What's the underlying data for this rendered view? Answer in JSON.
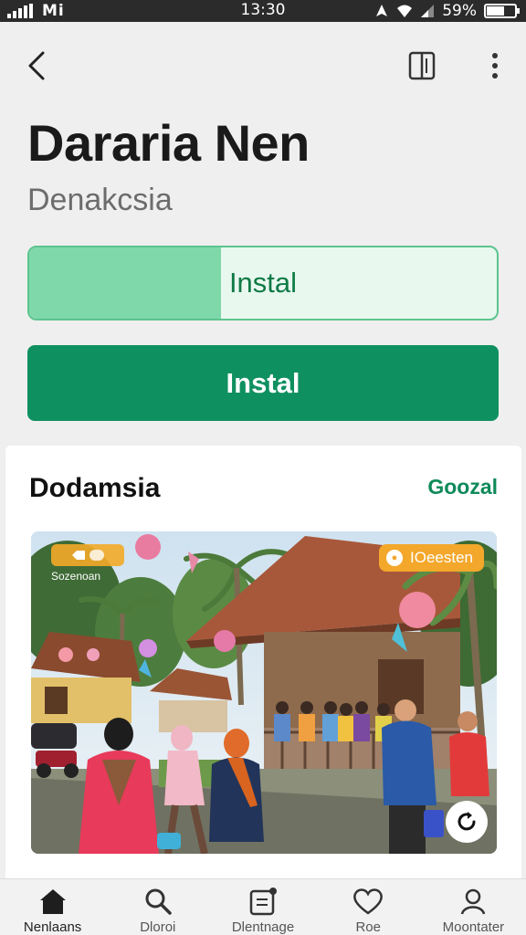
{
  "status_bar": {
    "carrier": "Mi",
    "time": "13:30",
    "battery": "59%",
    "battery_level": 0.59
  },
  "app": {
    "title": "Dararia Nen",
    "subtitle": "Denakcsia"
  },
  "download": {
    "label": "Instal",
    "progress": 0.41
  },
  "install_button": {
    "label": "Instal"
  },
  "card": {
    "title": "Dodamsia",
    "link": "Goozal",
    "photo": {
      "badge_left_caption": "Sozenoan",
      "badge_right": "IOeesten",
      "icon": "village-photo"
    }
  },
  "bottom_nav": {
    "items": [
      {
        "label": "Nenlaans",
        "icon": "home-icon"
      },
      {
        "label": "Dloroi",
        "icon": "search-icon"
      },
      {
        "label": "Dlentnage",
        "icon": "notes-icon"
      },
      {
        "label": "Roe",
        "icon": "heart-icon"
      },
      {
        "label": "Moontater",
        "icon": "profile-icon"
      }
    ]
  },
  "colors": {
    "accent": "#0f9060",
    "progress_fill": "#7fd8aa",
    "badge": "#f3a72b"
  }
}
